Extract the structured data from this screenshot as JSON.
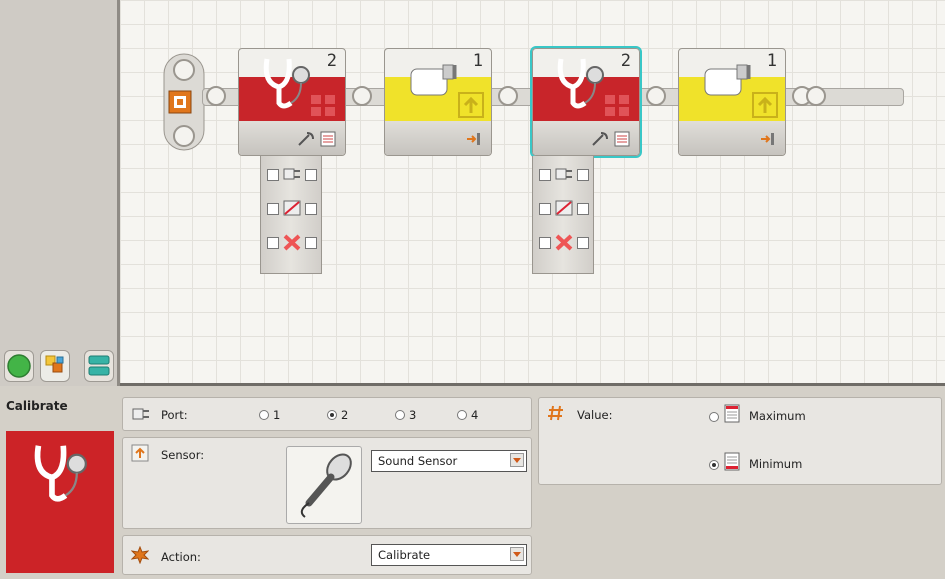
{
  "palette": {
    "tabs": [
      {
        "name": "common-palette",
        "icon": "green-circle-icon"
      },
      {
        "name": "complete-palette",
        "icon": "blocks-icon"
      },
      {
        "name": "custom-palette",
        "icon": "stack-icon"
      }
    ]
  },
  "canvas": {
    "blocks": [
      {
        "type": "Sensor wait (red)",
        "port": "2",
        "color": "#c8252a"
      },
      {
        "type": "Touch/Action (yellow)",
        "port": "1",
        "color": "#f0e22a"
      },
      {
        "type": "Sensor wait (red)",
        "port": "2",
        "color": "#c8252a"
      },
      {
        "type": "Touch/Action (yellow)",
        "port": "1",
        "color": "#f0e22a"
      }
    ]
  },
  "config": {
    "block_name": "Calibrate",
    "port": {
      "label": "Port:",
      "options": [
        "1",
        "2",
        "3",
        "4"
      ],
      "selected": "2"
    },
    "sensor": {
      "label": "Sensor:",
      "value": "Sound Sensor"
    },
    "action": {
      "label": "Action:",
      "value": "Calibrate"
    },
    "value": {
      "label": "Value:",
      "options": [
        "Maximum",
        "Minimum"
      ],
      "selected": "Minimum"
    }
  },
  "colors": {
    "accent_red": "#cc2327",
    "accent_yellow": "#f0e22a",
    "selection": "#39c7c7",
    "orange": "#e0761c"
  }
}
